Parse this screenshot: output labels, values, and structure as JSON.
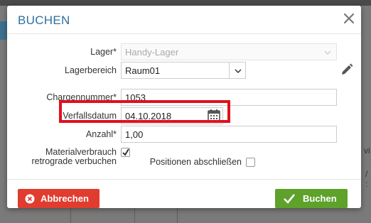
{
  "dialog": {
    "title": "BUCHEN"
  },
  "form": {
    "lager": {
      "label": "Lager*",
      "value": "Handy-Lager"
    },
    "lagerbereich": {
      "label": "Lagerbereich",
      "value": "Raum01"
    },
    "chargennummer": {
      "label": "Chargennummer*",
      "value": "1053"
    },
    "verfallsdatum": {
      "label": "Verfallsdatum",
      "value": "04.10.2018"
    },
    "anzahl": {
      "label": "Anzahl*",
      "value": "1,00"
    },
    "materialverbrauch": {
      "label_line1": "Materialverbrauch",
      "label_line2": "retrograde verbuchen",
      "checked": true
    },
    "positionen": {
      "label": "Positionen abschließen",
      "checked": false
    }
  },
  "footer": {
    "cancel_label": "Abbrechen",
    "book_label": "Buchen"
  },
  "background": {
    "right_text_1": "vi",
    "right_text_2": "/ :"
  },
  "colors": {
    "title": "#2f6fa0",
    "cancel": "#e03c2f",
    "book": "#5ea12b",
    "highlight": "#e0101e"
  },
  "icons": {
    "close": "close-icon",
    "caret": "chevron-down-icon",
    "edit": "pencil-icon",
    "calendar": "calendar-icon",
    "check": "checkmark-icon",
    "cancel": "x-circle-icon"
  }
}
